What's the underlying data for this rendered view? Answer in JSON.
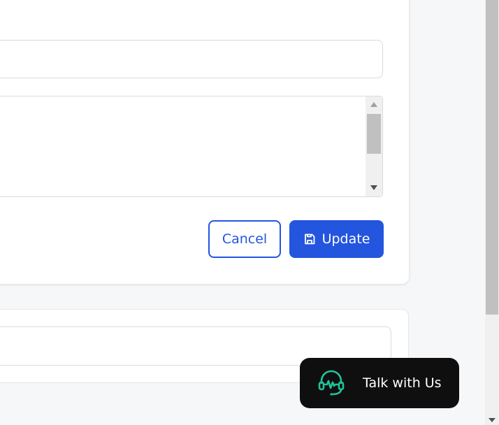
{
  "form": {
    "title_input": {
      "value": "",
      "placeholder": ""
    },
    "description_textarea": {
      "value": "",
      "placeholder": ""
    },
    "cancel_label": "Cancel",
    "update_label": "Update",
    "update_icon": "save-icon"
  },
  "lower_card": {
    "input": {
      "value": "",
      "placeholder": ""
    }
  },
  "chat_widget": {
    "label": "Talk with Us",
    "icon": "headset-icon",
    "icon_color": "#22c39a"
  },
  "colors": {
    "primary": "#2455df",
    "widget_bg": "#0f0f0f",
    "page_bg": "#f6f7f9"
  }
}
